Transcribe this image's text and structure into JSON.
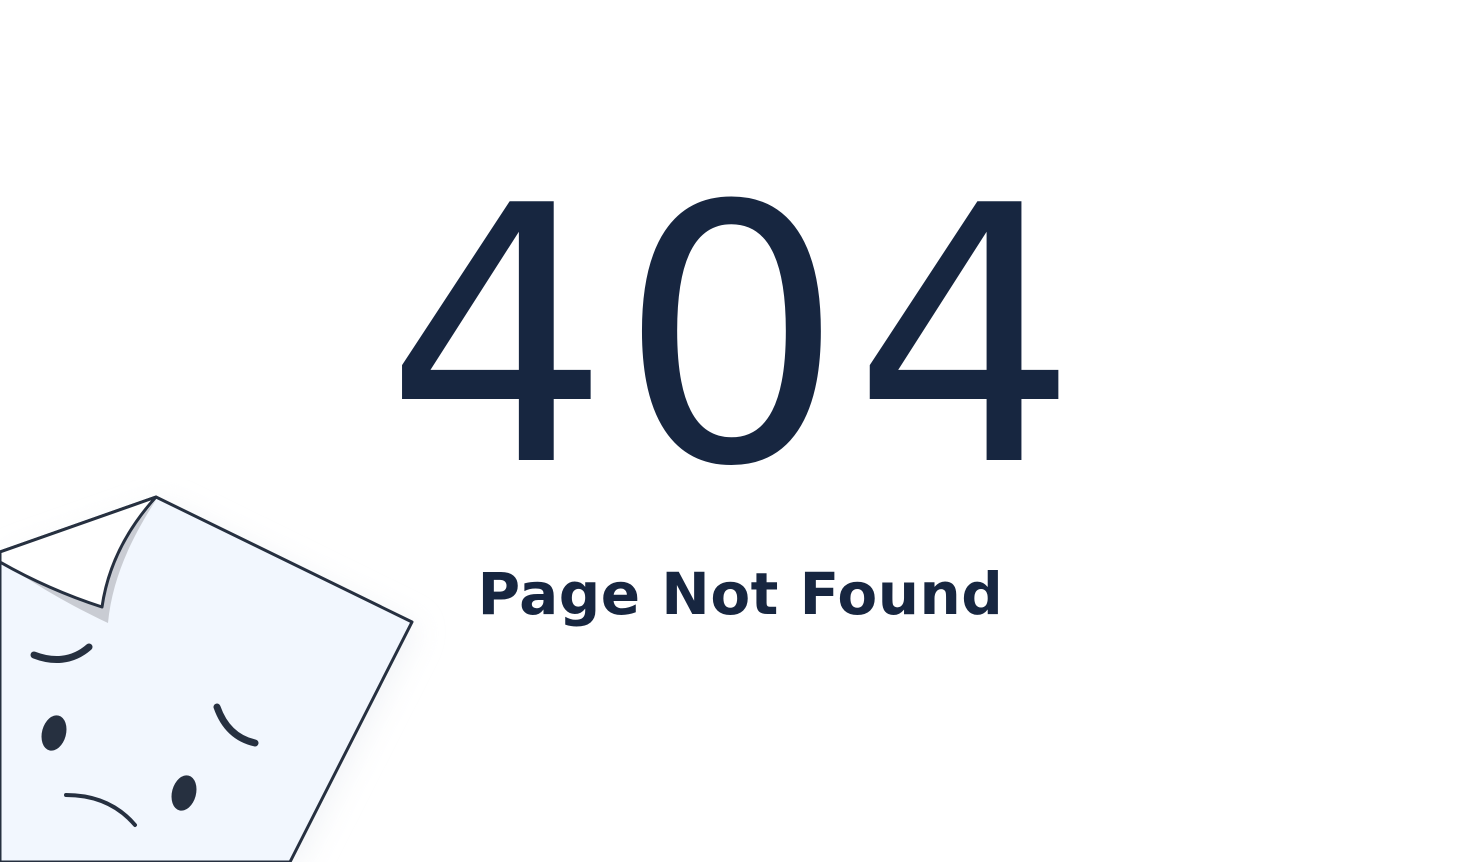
{
  "error": {
    "code": "404",
    "message": "Page Not Found"
  },
  "illustration": {
    "icon": "sad-page-icon"
  },
  "colors": {
    "text": "#172640",
    "background": "#ffffff",
    "page_fill": "#f2f7fe",
    "page_stroke": "#263040"
  }
}
